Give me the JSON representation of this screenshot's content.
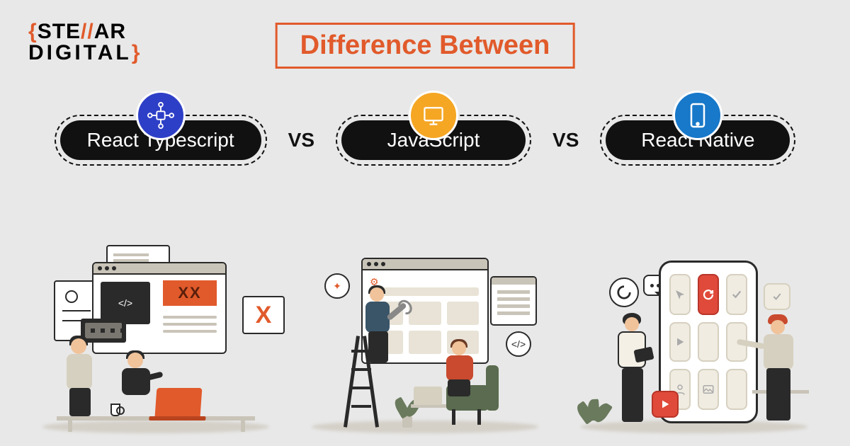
{
  "logo": {
    "line1_a": "STE",
    "line1_slash": "//",
    "line1_b": "AR",
    "line2": "DIGITAL"
  },
  "title": "Difference Between",
  "vs": "VS",
  "pills": {
    "typescript": {
      "label": "React Typescript",
      "icon": "network-icon"
    },
    "javascript": {
      "label": "JavaScript",
      "icon": "monitor-icon"
    },
    "native": {
      "label": "React Native",
      "icon": "mobile-icon"
    }
  },
  "colors": {
    "accent": "#e15a2b",
    "dark": "#111111",
    "bg": "#e8e8e8",
    "ts_icon": "#2e3fc7",
    "js_icon": "#f5a623",
    "rn_icon": "#1878c9"
  }
}
